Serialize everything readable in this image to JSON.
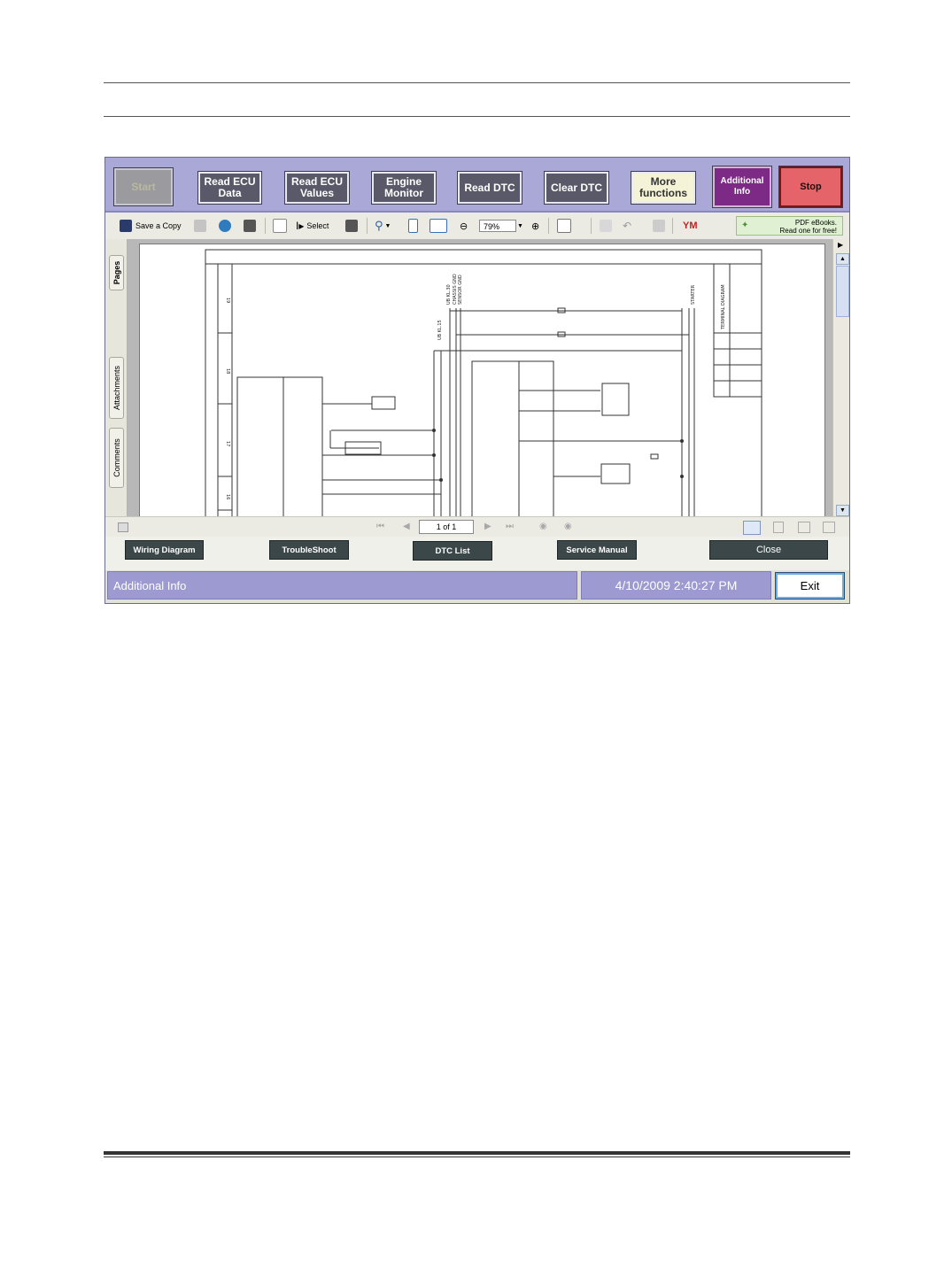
{
  "function_bar": {
    "start": "Start",
    "read_ecu_data": "Read ECU\nData",
    "read_ecu_values": "Read ECU\nValues",
    "engine_monitor": "Engine\nMonitor",
    "read_dtc": "Read DTC",
    "clear_dtc": "Clear DTC",
    "more_functions": "More\nfunctions",
    "additional_info": "Additional\nInfo",
    "stop": "Stop"
  },
  "pdf_toolbar": {
    "save_copy": "Save a Copy",
    "select": "Select",
    "zoom_value": "79%",
    "brand": "YM",
    "promo_line1": "PDF eBooks.",
    "promo_line2": "Read one for free!"
  },
  "side_tabs": [
    "Pages",
    "Attachments",
    "Comments"
  ],
  "diagram": {
    "sections": [
      "19",
      "18",
      "17",
      "16"
    ],
    "wire_labels": [
      "UB KL.30",
      "CHASSIS GND",
      "SENSOR GND",
      "UB KL.15",
      "STARTER",
      "TERMINAL DIAGRAM"
    ]
  },
  "navigation": {
    "page_indicator": "1 of 1"
  },
  "bottom_buttons": {
    "wiring_diagram": "Wiring Diagram",
    "troubleshoot": "TroubleShoot",
    "dtc_list": "DTC List",
    "service_manual": "Service Manual",
    "close": "Close"
  },
  "status_bar": {
    "section": "Additional Info",
    "datetime": "4/10/2009 2:40:27 PM",
    "exit": "Exit"
  },
  "colors": {
    "function_bar": "#a9a8d6",
    "dark_button": "#59596a",
    "additional_info": "#7c2a86",
    "stop": "#e4646a",
    "status_bar": "#9c9ad0"
  }
}
